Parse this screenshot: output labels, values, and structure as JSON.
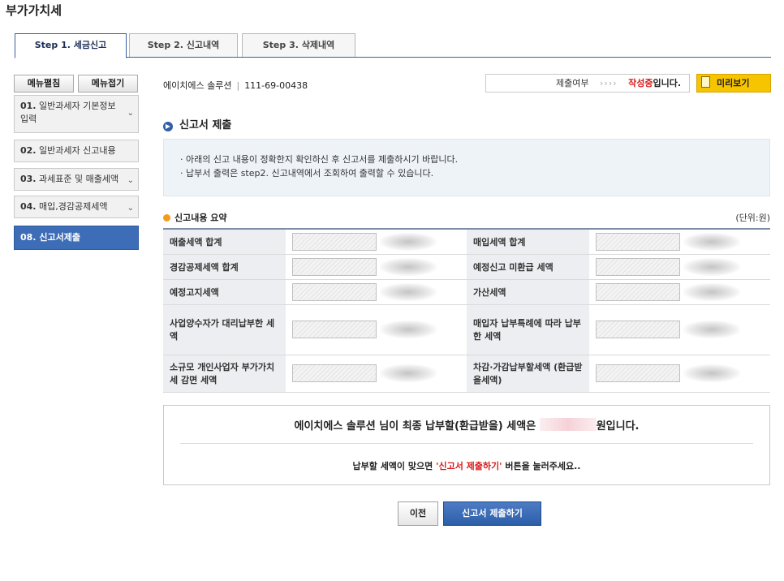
{
  "page_title": "부가가치세",
  "tabs": [
    {
      "label": "Step 1. 세금신고",
      "active": true
    },
    {
      "label": "Step 2. 신고내역",
      "active": false
    },
    {
      "label": "Step 3. 삭제내역",
      "active": false
    }
  ],
  "sidebar": {
    "expand_label": "메뉴펼침",
    "collapse_label": "메뉴접기",
    "items": [
      {
        "num": "01.",
        "label": "일반과세자 기본정보 입력"
      },
      {
        "num": "02.",
        "label": "일반과세자 신고내용"
      },
      {
        "num": "03.",
        "label": "과세표준 및 매출세액"
      },
      {
        "num": "04.",
        "label": "매입,경감공제세액"
      },
      {
        "num": "08.",
        "label": "신고서제출",
        "active": true
      }
    ]
  },
  "infobar": {
    "company_name": "에이치에스 솔루션",
    "business_number": "111-69-00438",
    "status_label": "제출여부",
    "status_arrows": "››››",
    "status_value": "작성중",
    "status_suffix": "입니다.",
    "preview_label": "미리보기"
  },
  "section": {
    "title": "신고서 제출",
    "notice_lines": [
      "· 아래의 신고 내용이 정확한지 확인하신 후 신고서를 제출하시기 바랍니다.",
      "· 납부서 출력은 step2. 신고내역에서 조회하여 출력할 수 있습니다."
    ]
  },
  "summary": {
    "title": "신고내용 요약",
    "unit": "(단위:원)",
    "rows": [
      {
        "left_label": "매출세액 합계",
        "right_label": "매입세액 합계"
      },
      {
        "left_label": "경감공제세액 합계",
        "right_label": "예정신고 미환급 세액"
      },
      {
        "left_label": "예정고지세액",
        "right_label": "가산세액"
      },
      {
        "left_label": "사업양수자가 대리납부한 세액",
        "right_label": "매입자 납부특례에 따라 납부한 세액"
      },
      {
        "left_label": "소규모 개인사업자 부가가치세 감면 세액",
        "right_label": "차감·가감납부할세액 (환급받을세액)"
      }
    ]
  },
  "result": {
    "prefix": "에이치에스 솔루션 님이 최종 납부할(환급받을) 세액은",
    "suffix": "원입니다.",
    "instruction_prefix": "납부할 세액이 맞으면",
    "instruction_highlight": "'신고서 제출하기'",
    "instruction_suffix": "버튼을 눌러주세요.."
  },
  "buttons": {
    "prev": "이전",
    "submit": "신고서 제출하기"
  },
  "colors": {
    "accent": "#3d6db7",
    "status_red": "#d81a1a",
    "preview_yellow": "#f7c400"
  }
}
